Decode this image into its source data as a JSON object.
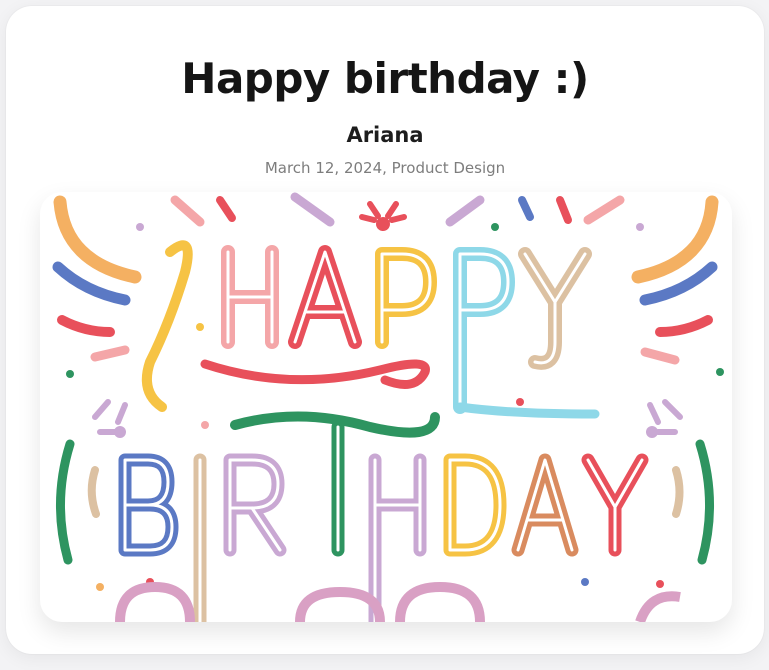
{
  "post": {
    "title": "Happy birthday :)",
    "author": "Ariana",
    "meta": "March 12, 2024, Product Design"
  },
  "image": {
    "icon": "birthday-lettering-illustration",
    "line1": "HAPPY",
    "line2": "BIRTHDAY",
    "palette": [
      "#f4a6a8",
      "#e8505b",
      "#f6c344",
      "#8ed8e8",
      "#dcc1a2",
      "#5b79c4",
      "#2e9460",
      "#c9a8d3",
      "#d98b5f"
    ]
  }
}
